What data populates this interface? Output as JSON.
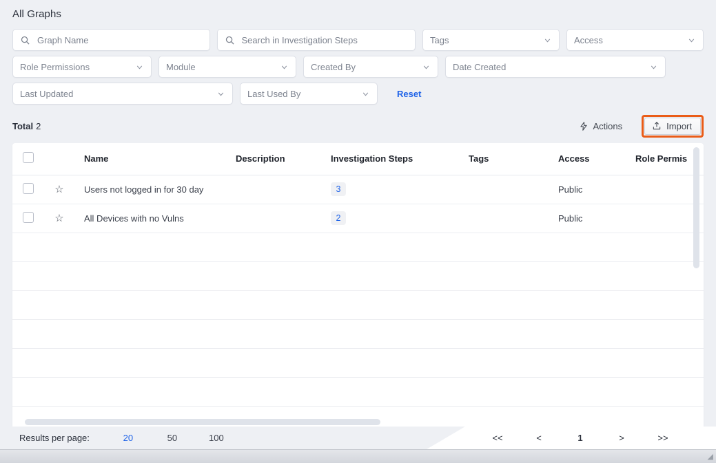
{
  "page": {
    "title": "All Graphs"
  },
  "filters": {
    "row1": [
      {
        "name": "graph-name-search",
        "type": "search",
        "placeholder": "Graph Name",
        "value": ""
      },
      {
        "name": "investigation-steps-search",
        "type": "search",
        "placeholder": "Search in Investigation Steps",
        "value": ""
      },
      {
        "name": "tags-select",
        "type": "select",
        "placeholder": "Tags",
        "value": ""
      },
      {
        "name": "access-select",
        "type": "select",
        "placeholder": "Access",
        "value": ""
      }
    ],
    "row2": [
      {
        "name": "role-permissions-select",
        "type": "select",
        "placeholder": "Role Permissions",
        "value": ""
      },
      {
        "name": "module-select",
        "type": "select",
        "placeholder": "Module",
        "value": ""
      },
      {
        "name": "created-by-select",
        "type": "select",
        "placeholder": "Created By",
        "value": ""
      },
      {
        "name": "date-created-select",
        "type": "select",
        "placeholder": "Date Created",
        "value": ""
      }
    ],
    "row3": [
      {
        "name": "last-updated-select",
        "type": "select",
        "placeholder": "Last Updated",
        "value": ""
      },
      {
        "name": "last-used-by-select",
        "type": "select",
        "placeholder": "Last Used By",
        "value": ""
      }
    ],
    "reset_label": "Reset"
  },
  "toolbar": {
    "total_label": "Total",
    "total_count": "2",
    "actions_label": "Actions",
    "actions_icon": "lightning-bolt-icon",
    "import_label": "Import",
    "import_icon": "upload-icon",
    "import_highlight_color": "#ea5c17"
  },
  "table": {
    "columns": [
      {
        "key": "select",
        "label": ""
      },
      {
        "key": "favorite",
        "label": ""
      },
      {
        "key": "name",
        "label": "Name"
      },
      {
        "key": "description",
        "label": "Description"
      },
      {
        "key": "investigation_steps",
        "label": "Investigation Steps"
      },
      {
        "key": "tags",
        "label": "Tags"
      },
      {
        "key": "access",
        "label": "Access"
      },
      {
        "key": "role_permissions",
        "label": "Role Permis"
      }
    ],
    "rows": [
      {
        "name": "Users not logged in for 30 day",
        "description": "",
        "investigation_steps": "3",
        "tags": "",
        "access": "Public",
        "role_permissions": ""
      },
      {
        "name": "All Devices with no Vulns",
        "description": "",
        "investigation_steps": "2",
        "tags": "",
        "access": "Public",
        "role_permissions": ""
      }
    ],
    "empty_row_count": 7
  },
  "footer": {
    "results_per_page_label": "Results per page:",
    "page_size_options": [
      {
        "label": "20",
        "active": true
      },
      {
        "label": "50",
        "active": false
      },
      {
        "label": "100",
        "active": false
      }
    ],
    "pagination": {
      "first_label": "<<",
      "prev_label": "<",
      "current_page": "1",
      "next_label": ">",
      "last_label": ">>"
    }
  },
  "colors": {
    "accent_blue": "#1f63e8",
    "highlight_orange": "#ea5c17",
    "page_bg": "#eef0f4",
    "card_bg": "#ffffff"
  }
}
